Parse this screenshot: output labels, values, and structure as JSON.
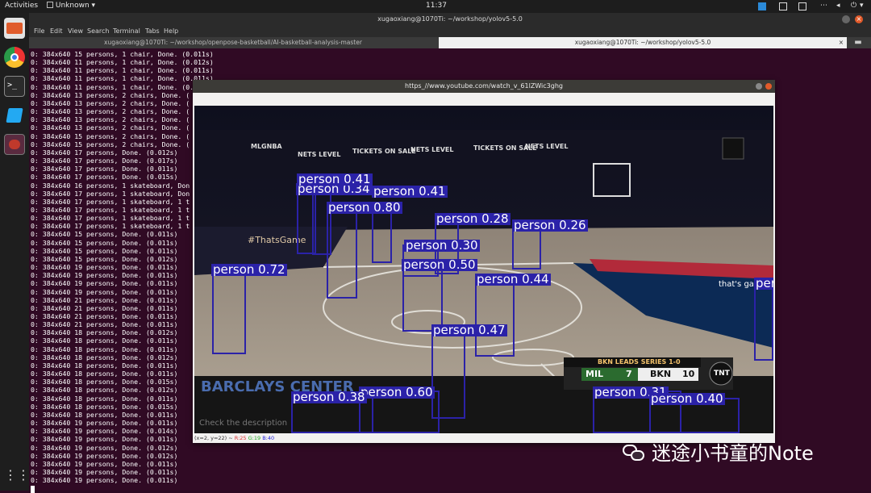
{
  "topbar": {
    "activities": "Activities",
    "app_menu": "Unknown",
    "clock": "11:37"
  },
  "terminal": {
    "window_title": "xugaoxiang@1070Ti: ~/workshop/yolov5-5.0",
    "menu": [
      "File",
      "Edit",
      "View",
      "Search",
      "Terminal",
      "Tabs",
      "Help"
    ],
    "tabs": [
      {
        "label": "xugaoxiang@1070Ti: ~/workshop/openpose-basketball/AI-basketball-analysis-master"
      },
      {
        "label": "xugaoxiang@1070Ti: ~/workshop/yolov5-5.0"
      }
    ],
    "lines": [
      "0: 384x640 15 persons, 1 chair, Done. (0.011s)",
      "0: 384x640 11 persons, 1 chair, Done. (0.012s)",
      "0: 384x640 11 persons, 1 chair, Done. (0.011s)",
      "0: 384x640 11 persons, 1 chair, Done. (0.011s)",
      "0: 384x640 11 persons, 1 chair, Done. (0.011s)",
      "0: 384x640 13 persons, 2 chairs, Done. (",
      "0: 384x640 13 persons, 2 chairs, Done. (",
      "0: 384x640 13 persons, 2 chairs, Done. (",
      "0: 384x640 13 persons, 2 chairs, Done. (",
      "0: 384x640 13 persons, 2 chairs, Done. (",
      "0: 384x640 15 persons, 2 chairs, Done. (",
      "0: 384x640 15 persons, 2 chairs, Done. (",
      "0: 384x640 17 persons, Done. (0.012s)",
      "0: 384x640 17 persons, Done. (0.017s)",
      "0: 384x640 17 persons, Done. (0.011s)",
      "0: 384x640 17 persons, Done. (0.015s)",
      "0: 384x640 16 persons, 1 skateboard, Don",
      "0: 384x640 17 persons, 1 skateboard, Don",
      "0: 384x640 17 persons, 1 skateboard, 1 t",
      "0: 384x640 17 persons, 1 skateboard, 1 t",
      "0: 384x640 17 persons, 1 skateboard, 1 t",
      "0: 384x640 17 persons, 1 skateboard, 1 t",
      "0: 384x640 15 persons, Done. (0.011s)",
      "0: 384x640 15 persons, Done. (0.011s)",
      "0: 384x640 15 persons, Done. (0.011s)",
      "0: 384x640 15 persons, Done. (0.012s)",
      "0: 384x640 19 persons, Done. (0.011s)",
      "0: 384x640 19 persons, Done. (0.011s)",
      "0: 384x640 19 persons, Done. (0.011s)",
      "0: 384x640 19 persons, Done. (0.011s)",
      "0: 384x640 21 persons, Done. (0.011s)",
      "0: 384x640 21 persons, Done. (0.011s)",
      "0: 384x640 21 persons, Done. (0.011s)",
      "0: 384x640 21 persons, Done. (0.011s)",
      "0: 384x640 18 persons, Done. (0.012s)",
      "0: 384x640 18 persons, Done. (0.011s)",
      "0: 384x640 18 persons, Done. (0.011s)",
      "0: 384x640 18 persons, Done. (0.012s)",
      "0: 384x640 18 persons, Done. (0.011s)",
      "0: 384x640 18 persons, Done. (0.011s)",
      "0: 384x640 18 persons, Done. (0.015s)",
      "0: 384x640 18 persons, Done. (0.012s)",
      "0: 384x640 18 persons, Done. (0.011s)",
      "0: 384x640 18 persons, Done. (0.015s)",
      "0: 384x640 18 persons, Done. (0.011s)",
      "0: 384x640 19 persons, Done. (0.011s)",
      "0: 384x640 19 persons, Done. (0.014s)",
      "0: 384x640 19 persons, Done. (0.011s)",
      "0: 384x640 19 persons, Done. (0.012s)",
      "0: 384x640 19 persons, Done. (0.012s)",
      "0: 384x640 19 persons, Done. (0.011s)",
      "0: 384x640 19 persons, Done. (0.011s)",
      "0: 384x640 19 persons, Done. (0.011s)"
    ]
  },
  "video": {
    "window_title": "https_//www.youtube.com/watch_v_61lZWic3ghg",
    "status": "(x=2, y=22) ~ ",
    "status_r": "R:25",
    "status_g": "G:19",
    "status_b": "B:40",
    "faded_text": "Check the description",
    "court_texts": [
      "MLGNBA",
      "NETS LEVEL",
      "TICKETS ON SALE",
      "NETS LEVEL",
      "TICKETS ON SALE",
      "NETS LEVEL",
      "#ThatsGame",
      "that's game",
      "BKN LEADS SERIES 1-0",
      "MIL",
      "7",
      "BKN",
      "10",
      "TNT",
      "BARCLAYS CENTER"
    ],
    "detections": [
      {
        "label": "person 0.41"
      },
      {
        "label": "person 0.34"
      },
      {
        "label": "person 0.41"
      },
      {
        "label": "person 0.80"
      },
      {
        "label": "person 0.28"
      },
      {
        "label": "person 0.26"
      },
      {
        "label": "person 0.30"
      },
      {
        "label": "person 0.72"
      },
      {
        "label": "person 0.50"
      },
      {
        "label": "person 0.44"
      },
      {
        "label": "person 0.47"
      },
      {
        "label": "person 0.38"
      },
      {
        "label": "person 0.60"
      },
      {
        "label": "person 0.31"
      },
      {
        "label": "person 0.40"
      },
      {
        "label": "per"
      }
    ]
  },
  "watermark": "迷途小书童的Note",
  "colors": {
    "box": "#2b22a8",
    "terminal_bg": "#300a24"
  }
}
